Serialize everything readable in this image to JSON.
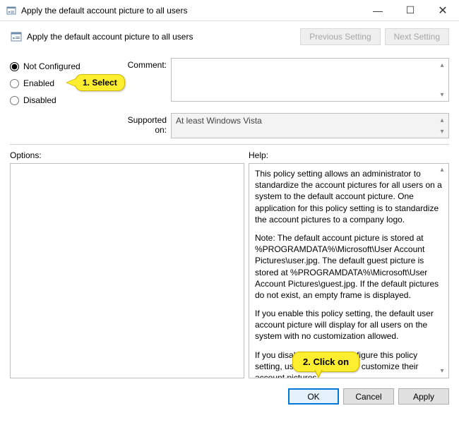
{
  "title": "Apply the default account picture to all users",
  "header": {
    "title": "Apply the default account picture to all users"
  },
  "nav": {
    "previous": "Previous Setting",
    "next": "Next Setting"
  },
  "state": {
    "options": {
      "not_configured": "Not Configured",
      "enabled": "Enabled",
      "disabled": "Disabled",
      "selected": "not_configured"
    }
  },
  "labels": {
    "comment": "Comment:",
    "supported_on": "Supported on:",
    "options": "Options:",
    "help": "Help:"
  },
  "supported_text": "At least Windows Vista",
  "help": {
    "p1": "This policy setting allows an administrator to standardize the account pictures for all users on a system to the default account picture. One application for this policy setting is to standardize the account pictures to a company logo.",
    "p2": "Note: The default account picture is stored at %PROGRAMDATA%\\Microsoft\\User Account Pictures\\user.jpg. The default guest picture is stored at %PROGRAMDATA%\\Microsoft\\User Account Pictures\\guest.jpg. If the default pictures do not exist, an empty frame is displayed.",
    "p3": "If you enable this policy setting, the default user account picture will display for all users on the system with no customization allowed.",
    "p4": "If you disable or do not configure this policy setting, users will be able to customize their account pictures."
  },
  "buttons": {
    "ok": "OK",
    "cancel": "Cancel",
    "apply": "Apply"
  },
  "annotations": {
    "select": "1.  Select",
    "click_on": "2.  Click on"
  }
}
